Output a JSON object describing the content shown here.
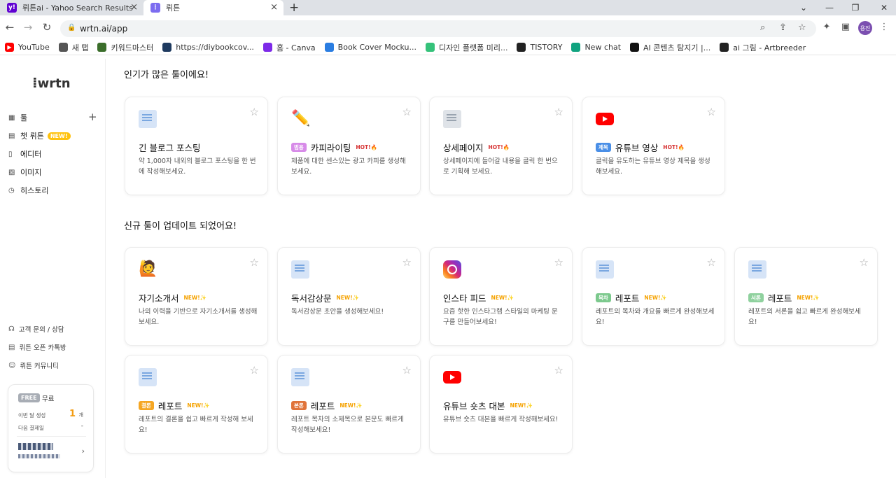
{
  "browser": {
    "tabs": [
      {
        "title": "뤼튼ai - Yahoo Search Results",
        "favicon": "y!",
        "favicon_color": "#6001d2"
      },
      {
        "title": "뤼튼",
        "favicon": "⋮",
        "favicon_color": "#7c6cf0"
      }
    ],
    "new_tab_label": "+",
    "url": "wrtn.ai/app",
    "profile_initials": "용진",
    "bookmarks": [
      {
        "label": "YouTube",
        "icon": "youtube-icon",
        "color": "#ff0000"
      },
      {
        "label": "새 탭",
        "icon": "globe-icon",
        "color": "#555555"
      },
      {
        "label": "키워드마스터",
        "icon": "keyword-icon",
        "color": "#3b6e2b"
      },
      {
        "label": "https://diybookcov...",
        "icon": "diy-icon",
        "color": "#1e3a5f"
      },
      {
        "label": "홈 - Canva",
        "icon": "canva-icon",
        "color": "#7d2ae8"
      },
      {
        "label": "Book Cover Mocku...",
        "icon": "mockup-icon",
        "color": "#2a7de1"
      },
      {
        "label": "디자인 플랫폼 미리...",
        "icon": "miri-icon",
        "color": "#35c27a"
      },
      {
        "label": "TISTORY",
        "icon": "tistory-icon",
        "color": "#222222"
      },
      {
        "label": "New chat",
        "icon": "chatgpt-icon",
        "color": "#10a37f"
      },
      {
        "label": "AI 콘텐츠 탐지기 |...",
        "icon": "writer-icon",
        "color": "#111111"
      },
      {
        "label": "ai 그림 - Artbreeder",
        "icon": "artbreeder-icon",
        "color": "#222222"
      }
    ]
  },
  "sidebar": {
    "logo": "wrtn",
    "nav": [
      {
        "label": "툴",
        "icon": "grid-icon"
      },
      {
        "label": "챗 뤼튼",
        "icon": "chat-icon",
        "badge": "NEW!"
      },
      {
        "label": "에디터",
        "icon": "document-icon"
      },
      {
        "label": "이미지",
        "icon": "image-icon"
      },
      {
        "label": "히스토리",
        "icon": "clock-icon"
      }
    ],
    "links": [
      {
        "label": "고객 문의 / 상담",
        "icon": "headset-icon"
      },
      {
        "label": "뤼튼 오픈 카톡방",
        "icon": "chat-icon"
      },
      {
        "label": "뤼튼 커뮤니티",
        "icon": "community-icon"
      }
    ],
    "plan": {
      "badge": "FREE",
      "name": "무료",
      "usage_label": "이번 달 생성",
      "usage_count": "1",
      "usage_unit": "개",
      "billing_label": "다음 결제일",
      "billing_value": "-"
    }
  },
  "sections": {
    "popular_title": "인기가 많은 툴이에요!",
    "new_title": "신규 툴이 업데이트 되었어요!"
  },
  "popular": [
    {
      "title": "긴 블로그 포스팅",
      "desc": "약 1,000자 내외의 블로그 포스팅을 한 번에 작성해보세요.",
      "icon": "document-icon",
      "tag": "",
      "hot": ""
    },
    {
      "title": "카피라이팅",
      "desc": "제품에 대한 센스있는 광고 카피를 생성해보세요.",
      "icon": "pencil-icon",
      "tag": "범용",
      "tag_color": "#d78be8",
      "hot": "HOT!🔥"
    },
    {
      "title": "상세페이지",
      "desc": "상세페이지에 들어갈 내용을 클릭 한 번으로 기획해 보세요.",
      "icon": "webpage-icon",
      "tag": "",
      "hot": "HOT!🔥"
    },
    {
      "title": "유튜브 영상",
      "desc": "클릭을 유도하는 유튜브 영상 제목을 생성해보세요.",
      "icon": "youtube-icon",
      "tag": "제목",
      "tag_color": "#4a8fe7",
      "hot": "HOT!🔥"
    }
  ],
  "new_tools": [
    {
      "title": "자기소개서",
      "desc": "나의 이력을 기반으로 자기소개서를 생성해보세요.",
      "icon": "person-icon",
      "tag": "",
      "new": "NEW!✨"
    },
    {
      "title": "독서감상문",
      "desc": "독서감상문 초안을 생성해보세요!",
      "icon": "document-icon",
      "tag": "",
      "new": "NEW!✨"
    },
    {
      "title": "인스타 피드",
      "desc": "요즘 핫한 인스타그램 스타일의 마케팅 문구를 만들어보세요!",
      "icon": "instagram-icon",
      "tag": "",
      "new": "NEW!✨"
    },
    {
      "title": "레포트",
      "desc": "레포트의 목차와 개요를 빠르게 완성해보세요!",
      "icon": "document-icon",
      "tag": "목차",
      "tag_color": "#7cc98d",
      "new": "NEW!✨"
    },
    {
      "title": "레포트",
      "desc": "레포트의 서론을 쉽고 빠르게 완성해보세요!",
      "icon": "document-icon",
      "tag": "서론",
      "tag_color": "#8fd19e",
      "new": "NEW!✨"
    },
    {
      "title": "레포트",
      "desc": "레포트의 결론을 쉽고 빠르게 작성해 보세요!",
      "icon": "document-icon",
      "tag": "결론",
      "tag_color": "#f5a623",
      "new": "NEW!✨"
    },
    {
      "title": "레포트",
      "desc": "레포트 목차의 소제목으로 본문도 빠르게 작성해보세요!",
      "icon": "document-icon",
      "tag": "본론",
      "tag_color": "#e0733a",
      "new": "NEW!✨"
    },
    {
      "title": "유튜브 숏츠 대본",
      "desc": "유튜브 숏츠 대본을 빠르게 작성해보세요!",
      "icon": "youtube-icon",
      "tag": "",
      "new": "NEW!✨"
    }
  ]
}
